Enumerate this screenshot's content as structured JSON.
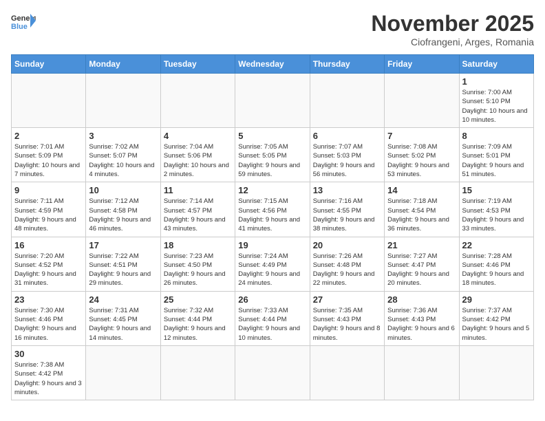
{
  "header": {
    "logo_general": "General",
    "logo_blue": "Blue",
    "month_title": "November 2025",
    "location": "Ciofrangeni, Arges, Romania"
  },
  "days_of_week": [
    "Sunday",
    "Monday",
    "Tuesday",
    "Wednesday",
    "Thursday",
    "Friday",
    "Saturday"
  ],
  "weeks": [
    [
      {
        "day": "",
        "info": ""
      },
      {
        "day": "",
        "info": ""
      },
      {
        "day": "",
        "info": ""
      },
      {
        "day": "",
        "info": ""
      },
      {
        "day": "",
        "info": ""
      },
      {
        "day": "",
        "info": ""
      },
      {
        "day": "1",
        "info": "Sunrise: 7:00 AM\nSunset: 5:10 PM\nDaylight: 10 hours and 10 minutes."
      }
    ],
    [
      {
        "day": "2",
        "info": "Sunrise: 7:01 AM\nSunset: 5:09 PM\nDaylight: 10 hours and 7 minutes."
      },
      {
        "day": "3",
        "info": "Sunrise: 7:02 AM\nSunset: 5:07 PM\nDaylight: 10 hours and 4 minutes."
      },
      {
        "day": "4",
        "info": "Sunrise: 7:04 AM\nSunset: 5:06 PM\nDaylight: 10 hours and 2 minutes."
      },
      {
        "day": "5",
        "info": "Sunrise: 7:05 AM\nSunset: 5:05 PM\nDaylight: 9 hours and 59 minutes."
      },
      {
        "day": "6",
        "info": "Sunrise: 7:07 AM\nSunset: 5:03 PM\nDaylight: 9 hours and 56 minutes."
      },
      {
        "day": "7",
        "info": "Sunrise: 7:08 AM\nSunset: 5:02 PM\nDaylight: 9 hours and 53 minutes."
      },
      {
        "day": "8",
        "info": "Sunrise: 7:09 AM\nSunset: 5:01 PM\nDaylight: 9 hours and 51 minutes."
      }
    ],
    [
      {
        "day": "9",
        "info": "Sunrise: 7:11 AM\nSunset: 4:59 PM\nDaylight: 9 hours and 48 minutes."
      },
      {
        "day": "10",
        "info": "Sunrise: 7:12 AM\nSunset: 4:58 PM\nDaylight: 9 hours and 46 minutes."
      },
      {
        "day": "11",
        "info": "Sunrise: 7:14 AM\nSunset: 4:57 PM\nDaylight: 9 hours and 43 minutes."
      },
      {
        "day": "12",
        "info": "Sunrise: 7:15 AM\nSunset: 4:56 PM\nDaylight: 9 hours and 41 minutes."
      },
      {
        "day": "13",
        "info": "Sunrise: 7:16 AM\nSunset: 4:55 PM\nDaylight: 9 hours and 38 minutes."
      },
      {
        "day": "14",
        "info": "Sunrise: 7:18 AM\nSunset: 4:54 PM\nDaylight: 9 hours and 36 minutes."
      },
      {
        "day": "15",
        "info": "Sunrise: 7:19 AM\nSunset: 4:53 PM\nDaylight: 9 hours and 33 minutes."
      }
    ],
    [
      {
        "day": "16",
        "info": "Sunrise: 7:20 AM\nSunset: 4:52 PM\nDaylight: 9 hours and 31 minutes."
      },
      {
        "day": "17",
        "info": "Sunrise: 7:22 AM\nSunset: 4:51 PM\nDaylight: 9 hours and 29 minutes."
      },
      {
        "day": "18",
        "info": "Sunrise: 7:23 AM\nSunset: 4:50 PM\nDaylight: 9 hours and 26 minutes."
      },
      {
        "day": "19",
        "info": "Sunrise: 7:24 AM\nSunset: 4:49 PM\nDaylight: 9 hours and 24 minutes."
      },
      {
        "day": "20",
        "info": "Sunrise: 7:26 AM\nSunset: 4:48 PM\nDaylight: 9 hours and 22 minutes."
      },
      {
        "day": "21",
        "info": "Sunrise: 7:27 AM\nSunset: 4:47 PM\nDaylight: 9 hours and 20 minutes."
      },
      {
        "day": "22",
        "info": "Sunrise: 7:28 AM\nSunset: 4:46 PM\nDaylight: 9 hours and 18 minutes."
      }
    ],
    [
      {
        "day": "23",
        "info": "Sunrise: 7:30 AM\nSunset: 4:46 PM\nDaylight: 9 hours and 16 minutes."
      },
      {
        "day": "24",
        "info": "Sunrise: 7:31 AM\nSunset: 4:45 PM\nDaylight: 9 hours and 14 minutes."
      },
      {
        "day": "25",
        "info": "Sunrise: 7:32 AM\nSunset: 4:44 PM\nDaylight: 9 hours and 12 minutes."
      },
      {
        "day": "26",
        "info": "Sunrise: 7:33 AM\nSunset: 4:44 PM\nDaylight: 9 hours and 10 minutes."
      },
      {
        "day": "27",
        "info": "Sunrise: 7:35 AM\nSunset: 4:43 PM\nDaylight: 9 hours and 8 minutes."
      },
      {
        "day": "28",
        "info": "Sunrise: 7:36 AM\nSunset: 4:43 PM\nDaylight: 9 hours and 6 minutes."
      },
      {
        "day": "29",
        "info": "Sunrise: 7:37 AM\nSunset: 4:42 PM\nDaylight: 9 hours and 5 minutes."
      }
    ],
    [
      {
        "day": "30",
        "info": "Sunrise: 7:38 AM\nSunset: 4:42 PM\nDaylight: 9 hours and 3 minutes."
      },
      {
        "day": "",
        "info": ""
      },
      {
        "day": "",
        "info": ""
      },
      {
        "day": "",
        "info": ""
      },
      {
        "day": "",
        "info": ""
      },
      {
        "day": "",
        "info": ""
      },
      {
        "day": "",
        "info": ""
      }
    ]
  ]
}
